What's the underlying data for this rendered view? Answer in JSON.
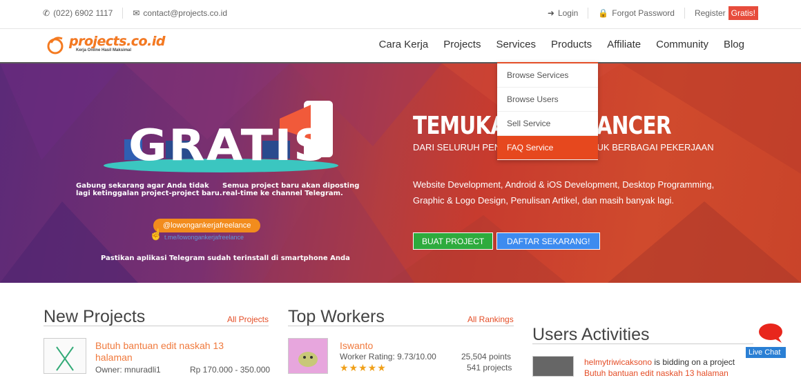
{
  "topbar": {
    "phone": "(022) 6902 1117",
    "email": "contact@projects.co.id",
    "login": "Login",
    "forgot": "Forgot Password",
    "register": "Register",
    "gratis": "Gratis!"
  },
  "logo": {
    "main": "projects.co.id",
    "tagline": "Kerja Online Hasil Maksimal"
  },
  "nav": [
    "Cara Kerja",
    "Projects",
    "Services",
    "Products",
    "Affiliate",
    "Community",
    "Blog"
  ],
  "dropdown": [
    "Browse Services",
    "Browse Users",
    "Sell Service",
    "FAQ Service"
  ],
  "hero": {
    "title": "TEMUKAN FREELANCER",
    "subtitle": "DARI SELURUH PENJURU INDONESIA UNTUK BERBAGAI PEKERJAAN",
    "description": "Website Development, Android & iOS Development, Desktop Programming, Graphic & Logo Design, Penulisan Artikel, dan masih banyak lagi.",
    "btn_project": "BUAT PROJECT",
    "btn_register": "DAFTAR SEKARANG!",
    "promo_big": "GRATIS",
    "promo_left": [
      "Gabung sekarang agar Anda tidak",
      "lagi ketinggalan project-project baru."
    ],
    "promo_right": [
      "Semua project baru akan diposting",
      "real-time ke channel Telegram."
    ],
    "telegram_handle": "@lowongankerjafreelance",
    "telegram_link": "t.me/lowongankerjafreelance",
    "install_note": "Pastikan aplikasi Telegram sudah terinstall di smartphone Anda"
  },
  "new_projects": {
    "title": "New Projects",
    "link": "All Projects",
    "item": {
      "title_1": "Butuh bantuan edit naskah 13",
      "title_2": "halaman",
      "owner": "Owner: mnuradli1",
      "budget": "Rp 170.000 - 350.000"
    }
  },
  "top_workers": {
    "title": "Top Workers",
    "link": "All Rankings",
    "item": {
      "name": "Iswanto",
      "rating": "Worker Rating: 9.73/10.00",
      "stars": "★★★★★",
      "points": "25,504 points",
      "projects": "541 projects"
    }
  },
  "activities": {
    "title": "Users Activities",
    "item": {
      "user": "helmytriwicaksono",
      "text": " is bidding on a project",
      "project": "Butuh bantuan edit naskah 13 halaman"
    }
  },
  "livechat": "Live Chat"
}
